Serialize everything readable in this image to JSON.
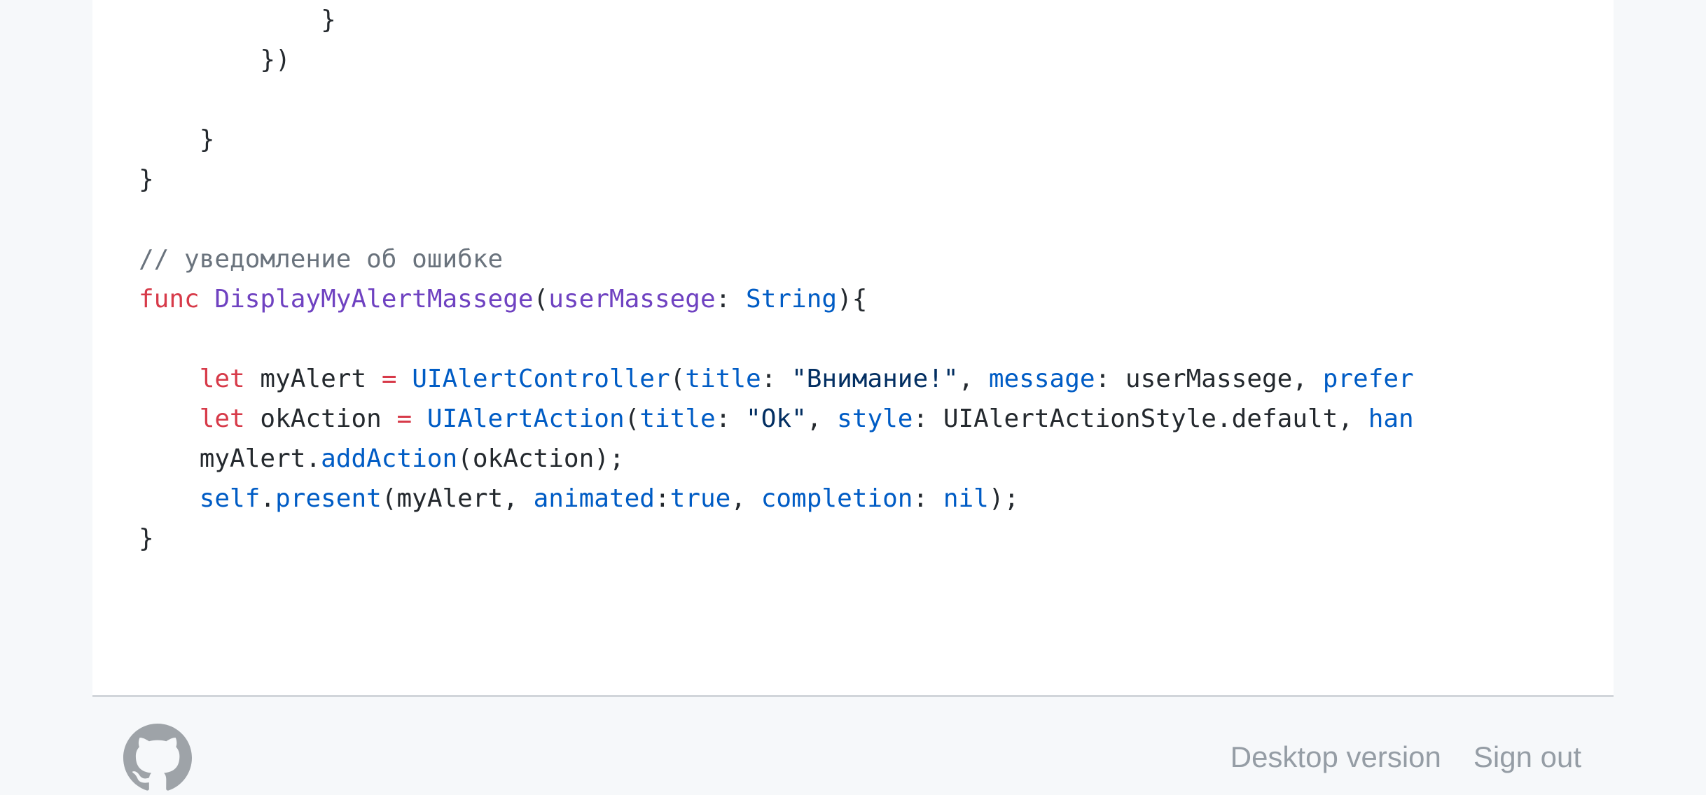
{
  "code": {
    "lines": [
      [
        {
          "t": "            }",
          "c": "plain"
        }
      ],
      [
        {
          "t": "        })",
          "c": "plain"
        }
      ],
      [],
      [
        {
          "t": "    }",
          "c": "plain"
        }
      ],
      [
        {
          "t": "}",
          "c": "plain"
        }
      ],
      [],
      [
        {
          "t": "// уведомление об ошибке",
          "c": "comment"
        }
      ],
      [
        {
          "t": "func",
          "c": "kw"
        },
        {
          "t": " ",
          "c": "plain"
        },
        {
          "t": "DisplayMyAlertMassege",
          "c": "fn"
        },
        {
          "t": "(",
          "c": "plain"
        },
        {
          "t": "userMassege",
          "c": "fn"
        },
        {
          "t": ": ",
          "c": "plain"
        },
        {
          "t": "String",
          "c": "type"
        },
        {
          "t": "){",
          "c": "plain"
        }
      ],
      [],
      [
        {
          "t": "    ",
          "c": "plain"
        },
        {
          "t": "let",
          "c": "kw"
        },
        {
          "t": " myAlert ",
          "c": "plain"
        },
        {
          "t": "=",
          "c": "kw"
        },
        {
          "t": " ",
          "c": "plain"
        },
        {
          "t": "UIAlertController",
          "c": "type"
        },
        {
          "t": "(",
          "c": "plain"
        },
        {
          "t": "title",
          "c": "prop"
        },
        {
          "t": ": ",
          "c": "plain"
        },
        {
          "t": "\"Внимание!\"",
          "c": "str"
        },
        {
          "t": ", ",
          "c": "plain"
        },
        {
          "t": "message",
          "c": "prop"
        },
        {
          "t": ": userMassege, ",
          "c": "plain"
        },
        {
          "t": "prefer",
          "c": "prop"
        }
      ],
      [
        {
          "t": "    ",
          "c": "plain"
        },
        {
          "t": "let",
          "c": "kw"
        },
        {
          "t": " okAction ",
          "c": "plain"
        },
        {
          "t": "=",
          "c": "kw"
        },
        {
          "t": " ",
          "c": "plain"
        },
        {
          "t": "UIAlertAction",
          "c": "type"
        },
        {
          "t": "(",
          "c": "plain"
        },
        {
          "t": "title",
          "c": "prop"
        },
        {
          "t": ": ",
          "c": "plain"
        },
        {
          "t": "\"Ok\"",
          "c": "str"
        },
        {
          "t": ", ",
          "c": "plain"
        },
        {
          "t": "style",
          "c": "prop"
        },
        {
          "t": ": UIAlertActionStyle.default, ",
          "c": "plain"
        },
        {
          "t": "han",
          "c": "prop"
        }
      ],
      [
        {
          "t": "    myAlert.",
          "c": "plain"
        },
        {
          "t": "addAction",
          "c": "prop"
        },
        {
          "t": "(okAction);",
          "c": "plain"
        }
      ],
      [
        {
          "t": "    ",
          "c": "plain"
        },
        {
          "t": "self",
          "c": "prop"
        },
        {
          "t": ".",
          "c": "plain"
        },
        {
          "t": "present",
          "c": "prop"
        },
        {
          "t": "(myAlert, ",
          "c": "plain"
        },
        {
          "t": "animated",
          "c": "prop"
        },
        {
          "t": ":",
          "c": "plain"
        },
        {
          "t": "true",
          "c": "prop"
        },
        {
          "t": ", ",
          "c": "plain"
        },
        {
          "t": "completion",
          "c": "prop"
        },
        {
          "t": ": ",
          "c": "plain"
        },
        {
          "t": "nil",
          "c": "prop"
        },
        {
          "t": ");",
          "c": "plain"
        }
      ],
      [
        {
          "t": "}",
          "c": "plain"
        }
      ]
    ]
  },
  "footer": {
    "desktop_version_label": "Desktop version",
    "sign_out_label": "Sign out",
    "logo_icon": "github-icon"
  },
  "colors": {
    "keyword": "#d73a49",
    "function": "#6f42c1",
    "type": "#005cc5",
    "string": "#032f62",
    "comment": "#6a737d",
    "footer_text": "#959da5",
    "logo": "#9ea3a8"
  }
}
